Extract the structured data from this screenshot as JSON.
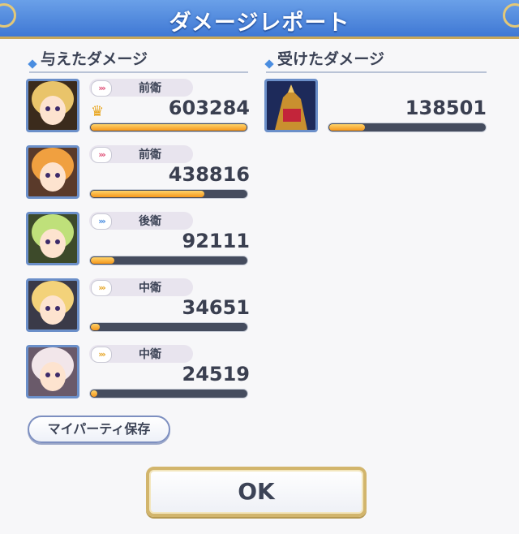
{
  "title": "ダメージレポート",
  "dealt": {
    "heading": "与えたダメージ",
    "rows": [
      {
        "role": "前衛",
        "role_icon": "forward-arrows",
        "damage": "603284",
        "mvp": true,
        "fill_ratio": 1.0,
        "arrow_color": "#e0557a"
      },
      {
        "role": "前衛",
        "role_icon": "forward-arrows",
        "damage": "438816",
        "mvp": false,
        "fill_ratio": 0.727,
        "arrow_color": "#e0557a"
      },
      {
        "role": "後衛",
        "role_icon": "back-arrows",
        "damage": "92111",
        "mvp": false,
        "fill_ratio": 0.153,
        "arrow_color": "#4a8de0"
      },
      {
        "role": "中衛",
        "role_icon": "middle-arrows",
        "damage": "34651",
        "mvp": false,
        "fill_ratio": 0.057,
        "arrow_color": "#e6a72a"
      },
      {
        "role": "中衛",
        "role_icon": "middle-arrows",
        "damage": "24519",
        "mvp": false,
        "fill_ratio": 0.041,
        "arrow_color": "#e6a72a"
      }
    ]
  },
  "received": {
    "heading": "受けたダメージ",
    "rows": [
      {
        "damage": "138501",
        "fill_ratio": 0.23
      }
    ]
  },
  "buttons": {
    "my_party": "マイパーティ保存",
    "ok": "OK"
  },
  "colors": {
    "title_bar": "#4f88dc",
    "bar_fill": "#f5961c",
    "bar_track": "#454c5e",
    "gold_frame": "#d2b56c"
  }
}
